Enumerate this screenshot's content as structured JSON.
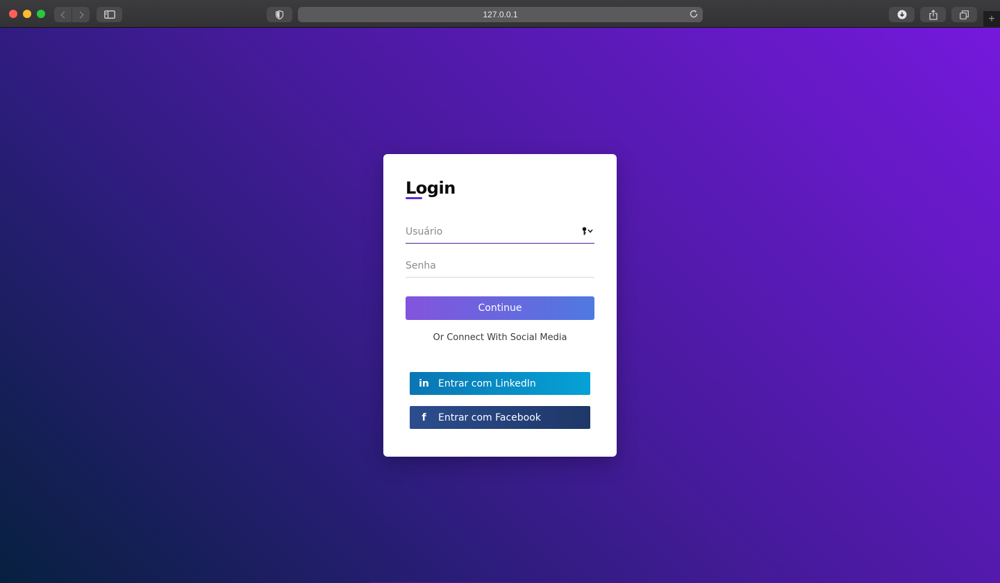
{
  "browser": {
    "url": "127.0.0.1",
    "newtab_label": "+"
  },
  "login": {
    "title": "Login",
    "username_placeholder": "Usuário",
    "password_placeholder": "Senha",
    "continue_label": "Continue",
    "social_prompt": "Or Connect With Social Media",
    "linkedin": {
      "icon_text": "in",
      "label": "Entrar com LinkedIn"
    },
    "facebook": {
      "icon_text": "f",
      "label": "Entrar com Facebook"
    }
  },
  "colors": {
    "accent": "#5b2bd6",
    "linkedin": "#0a76b3",
    "facebook": "#2c4d8e"
  },
  "icons": [
    "back-icon",
    "forward-icon",
    "sidebar-icon",
    "shield-icon",
    "reload-icon",
    "download-icon",
    "share-icon",
    "tabs-icon",
    "key-icon",
    "linkedin-icon",
    "facebook-icon"
  ]
}
